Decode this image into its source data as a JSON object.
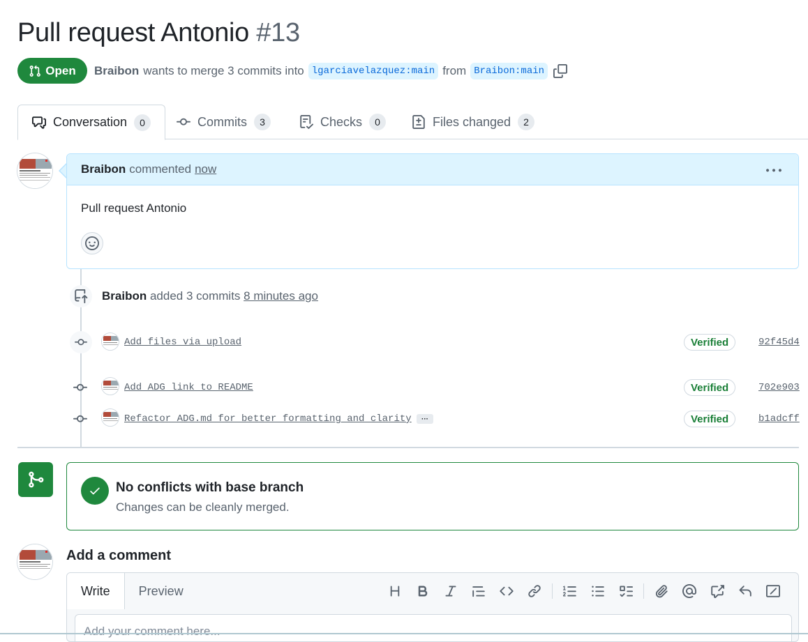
{
  "pr": {
    "title": "Pull request Antonio",
    "number": "#13",
    "state": "Open",
    "author": "Braibon",
    "merge_text": "wants to merge 3 commits into",
    "base_branch": "lgarciavelazquez:main",
    "from_text": "from",
    "head_branch": "Braibon:main"
  },
  "tabs": [
    {
      "label": "Conversation",
      "count": "0",
      "icon": "comment-discussion-icon"
    },
    {
      "label": "Commits",
      "count": "3",
      "icon": "git-commit-icon"
    },
    {
      "label": "Checks",
      "count": "0",
      "icon": "checklist-icon"
    },
    {
      "label": "Files changed",
      "count": "2",
      "icon": "file-diff-icon"
    }
  ],
  "comment": {
    "author": "Braibon",
    "action": "commented",
    "time": "now",
    "body": "Pull request Antonio"
  },
  "timeline": {
    "push_event": {
      "author": "Braibon",
      "action": "added 3 commits",
      "time": "8 minutes ago"
    },
    "commits": [
      {
        "message": "Add files via upload",
        "status": "Verified",
        "sha": "92f45d4"
      },
      {
        "message": "Add ADG link to README",
        "status": "Verified",
        "sha": "702e903"
      },
      {
        "message": "Refactor ADG.md for better formatting and clarity",
        "status": "Verified",
        "sha": "b1adcff",
        "ellipsis": "···"
      }
    ]
  },
  "merge_status": {
    "title": "No conflicts with base branch",
    "subtitle": "Changes can be cleanly merged."
  },
  "new_comment": {
    "heading": "Add a comment",
    "tabs": [
      "Write",
      "Preview"
    ],
    "placeholder": "Add your comment here..."
  },
  "colors": {
    "open_green": "#1f883d",
    "link_blue": "#0969da",
    "branch_bg": "#ddf4ff",
    "verified_green": "#1a7f37"
  }
}
